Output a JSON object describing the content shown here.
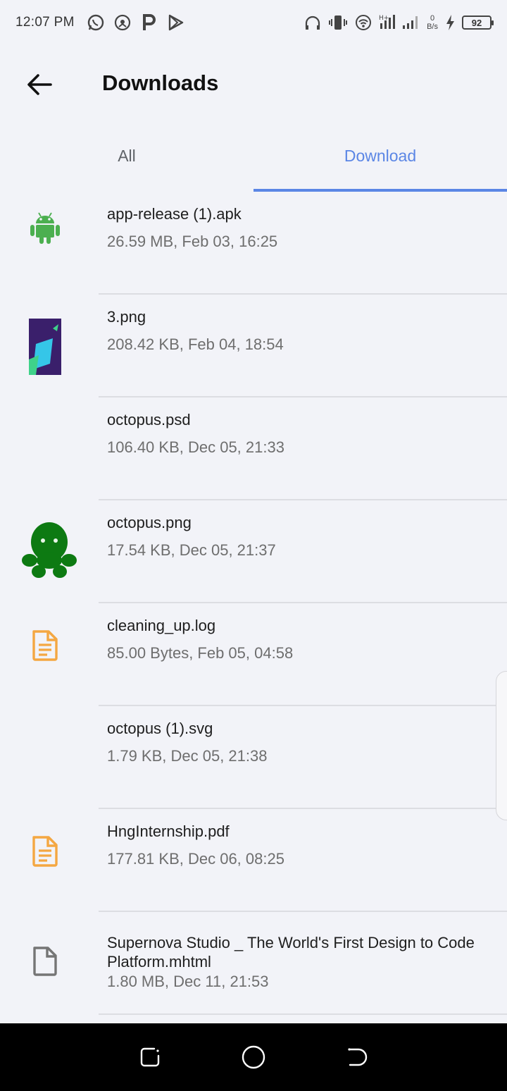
{
  "status_bar": {
    "time": "12:07 PM",
    "net_speed_value": "0",
    "net_speed_unit": "B/s",
    "battery": "92",
    "icons": [
      "whatsapp-icon",
      "hotspot-icon",
      "parking-p-icon",
      "play-store-icon",
      "headphones-icon",
      "vibrate-icon",
      "wifi-icon",
      "signal-icon",
      "charging-icon"
    ]
  },
  "header": {
    "title": "Downloads"
  },
  "tabs": [
    {
      "label": "All",
      "active": false
    },
    {
      "label": "Download",
      "active": true
    }
  ],
  "colors": {
    "accent": "#5b86e5",
    "android_green": "#4caf50",
    "doc_orange": "#f4a742",
    "octopus_green": "#0d7a12"
  },
  "files": [
    {
      "name": "app-release (1).apk",
      "meta": "26.59 MB, Feb 03, 16:25",
      "icon": "android-icon"
    },
    {
      "name": "3.png",
      "meta": "208.42 KB, Feb 04, 18:54",
      "icon": "image-thumbnail"
    },
    {
      "name": "octopus.psd",
      "meta": "106.40 KB, Dec 05, 21:33",
      "icon": ""
    },
    {
      "name": "octopus.png",
      "meta": "17.54 KB, Dec 05, 21:37",
      "icon": "octopus-thumbnail"
    },
    {
      "name": "cleaning_up.log",
      "meta": "85.00 Bytes, Feb 05, 04:58",
      "icon": "document-icon"
    },
    {
      "name": "octopus (1).svg",
      "meta": "1.79 KB, Dec 05, 21:38",
      "icon": ""
    },
    {
      "name": "HngInternship.pdf",
      "meta": "177.81 KB, Dec 06, 08:25",
      "icon": "document-icon"
    },
    {
      "name": "Supernova Studio _ The World's First Design to Code Platform.mhtml",
      "meta": "1.80 MB, Dec 11, 21:53",
      "icon": "file-icon"
    }
  ]
}
